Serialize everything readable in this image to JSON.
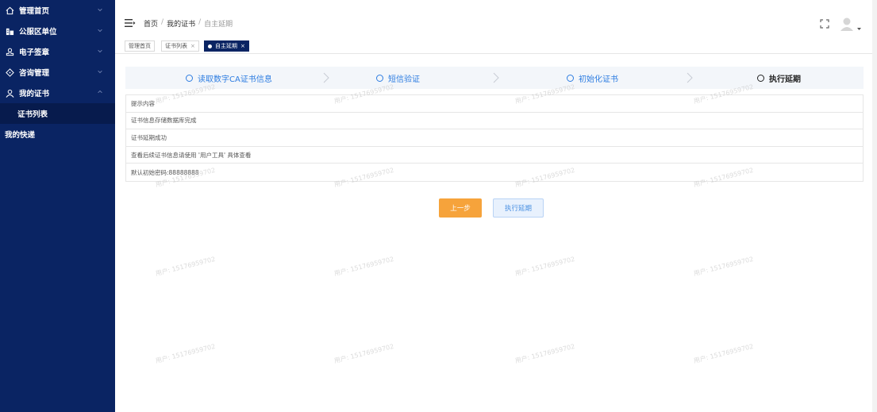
{
  "sidebar": {
    "items": [
      {
        "label": "管理首页",
        "icon": "home-icon",
        "chevron": "down"
      },
      {
        "label": "公服区单位",
        "icon": "building-icon",
        "chevron": "down"
      },
      {
        "label": "电子签章",
        "icon": "stamp-icon",
        "chevron": "down"
      },
      {
        "label": "咨询管理",
        "icon": "consult-icon",
        "chevron": "down"
      },
      {
        "label": "我的证书",
        "icon": "user-icon",
        "chevron": "up"
      }
    ],
    "subitem": "证书列表",
    "plain_item": "我的快递"
  },
  "header": {
    "breadcrumb": [
      "首页",
      "我的证书",
      "自主延期"
    ],
    "separator": "/"
  },
  "tags": [
    {
      "label": "管理首页",
      "active": false,
      "closable": false
    },
    {
      "label": "证书列表",
      "active": false,
      "closable": true
    },
    {
      "label": "自主延期",
      "active": true,
      "closable": true
    }
  ],
  "tag_close": "×",
  "steps": [
    {
      "label": "读取数字CA证书信息",
      "state": "done"
    },
    {
      "label": "短信验证",
      "state": "done"
    },
    {
      "label": "初始化证书",
      "state": "done"
    },
    {
      "label": "执行延期",
      "state": "current"
    }
  ],
  "info_rows": [
    "提示内容",
    "证书信息存储数据库完成",
    "证书延期成功",
    "查看后续证书信息请使用 '用户工具' 具体查看",
    "默认初始密码:88888888"
  ],
  "buttons": {
    "prev": "上一步",
    "execute": "执行延期"
  },
  "watermark": "用户: 15176959702",
  "colors": {
    "sidebar_bg": "#0a2463",
    "accent_blue": "#2e7de1",
    "orange": "#f6a33b"
  }
}
